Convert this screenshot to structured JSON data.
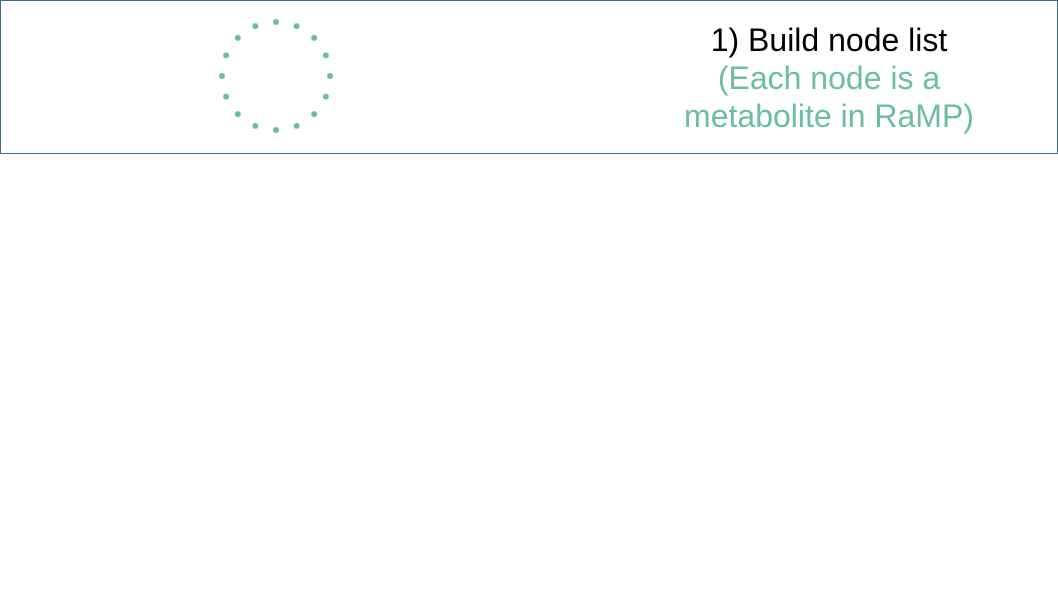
{
  "step": {
    "title": "1) Build node list",
    "subtitle_line1": "(Each node is a",
    "subtitle_line2": "metabolite in RaMP)"
  },
  "colors": {
    "accent": "#6bbf9e",
    "border": "#3f6a8a",
    "text": "#000000"
  },
  "diagram": {
    "node_count": 16
  }
}
